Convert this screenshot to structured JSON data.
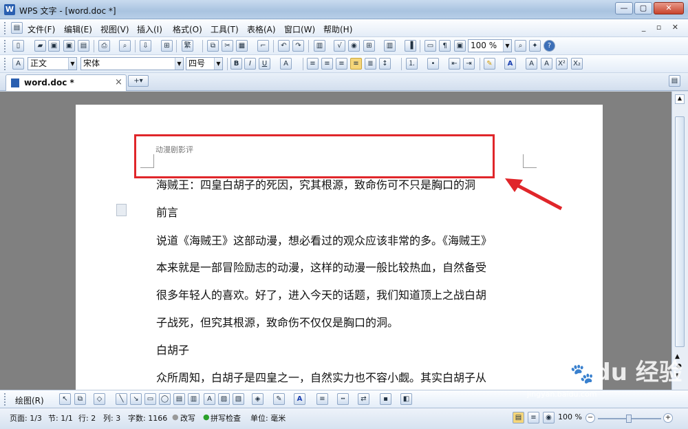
{
  "window": {
    "title": "WPS 文字 - [word.doc *]",
    "app_icon": "W"
  },
  "menu": [
    "文件(F)",
    "编辑(E)",
    "视图(V)",
    "插入(I)",
    "格式(O)",
    "工具(T)",
    "表格(A)",
    "窗口(W)",
    "帮助(H)"
  ],
  "toolbar": {
    "zoom": "100 %"
  },
  "format": {
    "style": "正文",
    "font": "宋体",
    "size": "四号"
  },
  "tab": {
    "label": "word.doc *"
  },
  "doc": {
    "header_text": "动漫剧影评",
    "lines": [
      "海贼王：四皇白胡子的死因，究其根源，致命伤可不只是胸口的洞",
      "前言",
      "说道《海贼王》这部动漫，想必看过的观众应该非常的多。《海贼王》",
      "本来就是一部冒险励志的动漫，这样的动漫一般比较热血，自然备受",
      "很多年轻人的喜欢。好了，进入今天的话题，我们知道顶上之战白胡",
      "子战死，但究其根源，致命伤不仅仅是胸口的洞。",
      "白胡子",
      "众所周知，白胡子是四皇之一，自然实力也不容小觑。其实白胡子从"
    ]
  },
  "draw": {
    "label": "绘图(R)"
  },
  "status": {
    "page": "页面: 1/3",
    "section": "节: 1/1",
    "row": "行: 2",
    "col": "列: 3",
    "words": "字数: 1166",
    "overwrite": "改写",
    "spell": "拼写检查",
    "unit": "单位: 毫米",
    "zoom": "100 %"
  },
  "watermark": {
    "logo": "Bai du 经验",
    "url": "jingyan.baidu.com"
  }
}
